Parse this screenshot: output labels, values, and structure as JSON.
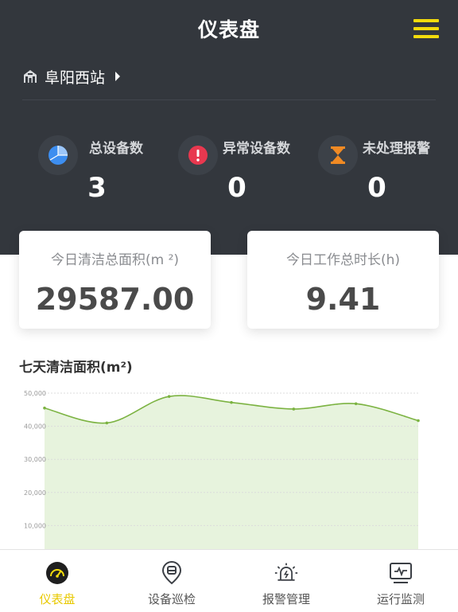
{
  "header": {
    "title": "仪表盘",
    "menu_icon": "menu-icon"
  },
  "station": {
    "name": "阜阳西站",
    "icon": "station-icon"
  },
  "stats": [
    {
      "label": "总设备数",
      "value": "3",
      "icon": "pie-chart-icon",
      "color": "#3d8ef0"
    },
    {
      "label": "异常设备数",
      "value": "0",
      "icon": "alert-icon",
      "color": "#e8384f"
    },
    {
      "label": "未处理报警",
      "value": "0",
      "icon": "hourglass-icon",
      "color": "#f08a24"
    }
  ],
  "cards": {
    "area_label": "今日清洁总面积(m ²)",
    "area_value": "29587.00",
    "time_label": "今日工作总时长(h)",
    "time_value": "9.41"
  },
  "chart_title": "七天清洁面积(m²)",
  "chart_data": {
    "type": "area",
    "y_ticks": [
      "10,000",
      "20,000",
      "30,000",
      "40,000",
      "50,000"
    ],
    "ylim": [
      0,
      50000
    ],
    "values": [
      45500,
      41000,
      49000,
      47200,
      45200,
      46800,
      41700
    ],
    "grid": true,
    "color": "#7cb342",
    "fill": "#e7f3dd"
  },
  "tabs": [
    {
      "label": "仪表盘",
      "icon": "dashboard-icon",
      "active": true
    },
    {
      "label": "设备巡检",
      "icon": "inspection-icon",
      "active": false
    },
    {
      "label": "报警管理",
      "icon": "alarm-icon",
      "active": false
    },
    {
      "label": "运行监测",
      "icon": "monitor-icon",
      "active": false
    }
  ],
  "colors": {
    "accent": "#f4dc0c",
    "header_bg": "#33373d"
  }
}
